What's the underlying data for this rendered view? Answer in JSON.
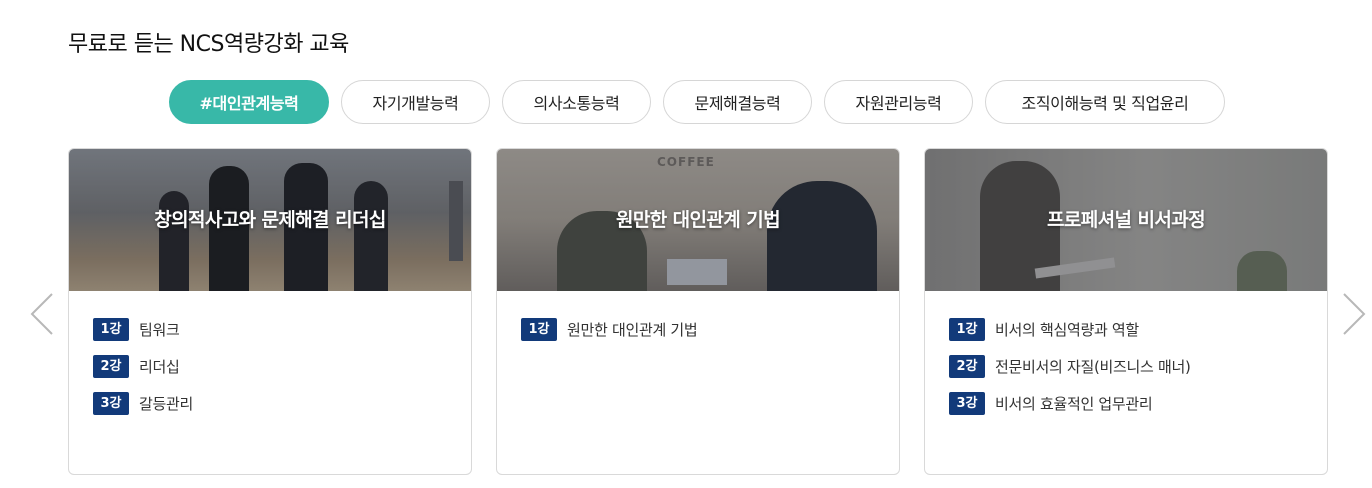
{
  "section": {
    "title": "무료로 듣는 NCS역량강화 교육"
  },
  "tabs": [
    {
      "label": "#대인관계능력",
      "active": true
    },
    {
      "label": "자기개발능력",
      "active": false
    },
    {
      "label": "의사소통능력",
      "active": false
    },
    {
      "label": "문제해결능력",
      "active": false
    },
    {
      "label": "자원관리능력",
      "active": false
    },
    {
      "label": "조직이해능력 및 직업윤리",
      "active": false
    }
  ],
  "carousel": {
    "prev_icon": "chevron-left-icon",
    "next_icon": "chevron-right-icon"
  },
  "cards": [
    {
      "title": "창의적사고와 문제해결 리더십",
      "image_desc": "businessmen walking",
      "lessons": [
        {
          "badge": "1강",
          "label": "팀워크"
        },
        {
          "badge": "2강",
          "label": "리더십"
        },
        {
          "badge": "3강",
          "label": "갈등관리"
        }
      ]
    },
    {
      "title": "원만한 대인관계 기법",
      "image_sign": "COFFEE",
      "lessons": [
        {
          "badge": "1강",
          "label": "원만한 대인관계 기법"
        }
      ]
    },
    {
      "title": "프로페셔널 비서과정",
      "image_desc": "woman with laptop",
      "lessons": [
        {
          "badge": "1강",
          "label": "비서의 핵심역량과 역할"
        },
        {
          "badge": "2강",
          "label": "전문비서의 자질(비즈니스 매너)"
        },
        {
          "badge": "3강",
          "label": "비서의 효율적인 업무관리"
        }
      ]
    }
  ],
  "colors": {
    "accent": "#38b8a8",
    "badge": "#123a7a",
    "border": "#d9d9d9"
  }
}
